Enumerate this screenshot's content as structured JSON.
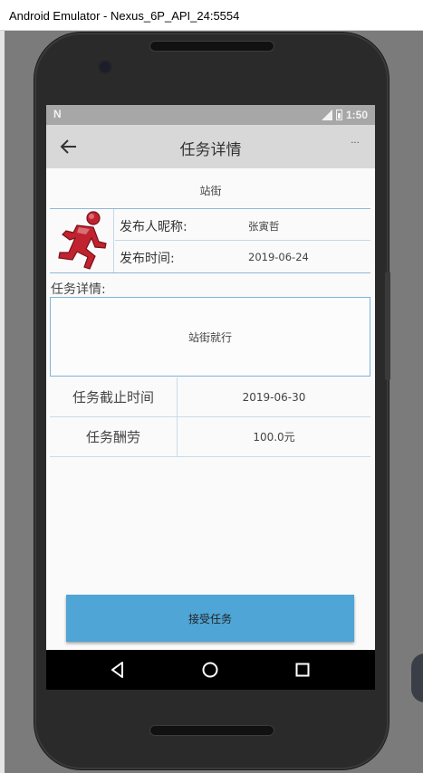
{
  "window": {
    "title": "Android Emulator - Nexus_6P_API_24:5554"
  },
  "status_bar": {
    "left_icon": "N",
    "time": "1:50",
    "icons": [
      "signal-icon",
      "battery-icon"
    ]
  },
  "app_bar": {
    "title": "任务详情",
    "overflow": "···",
    "back_icon": "arrow-left-icon"
  },
  "task": {
    "name": "站街",
    "publisher_label": "发布人昵称:",
    "publisher_value": "张寅哲",
    "publish_time_label": "发布时间:",
    "publish_time_value": "2019-06-24",
    "detail_heading": "任务详情:",
    "detail_text": "站街就行",
    "deadline_label": "任务截止时间",
    "deadline_value": "2019-06-30",
    "reward_label": "任务酬劳",
    "reward_value": "100.0元",
    "avatar_icon": "running-man-icon"
  },
  "actions": {
    "accept_label": "接受任务"
  },
  "nav_bar": {
    "icons": [
      "triangle-back-icon",
      "circle-home-icon",
      "square-recents-icon"
    ]
  },
  "colors": {
    "button": "#4ea5d6",
    "divider": "#90b8d6",
    "app_bar": "#d8d8d8",
    "avatar": "#c0232f"
  }
}
